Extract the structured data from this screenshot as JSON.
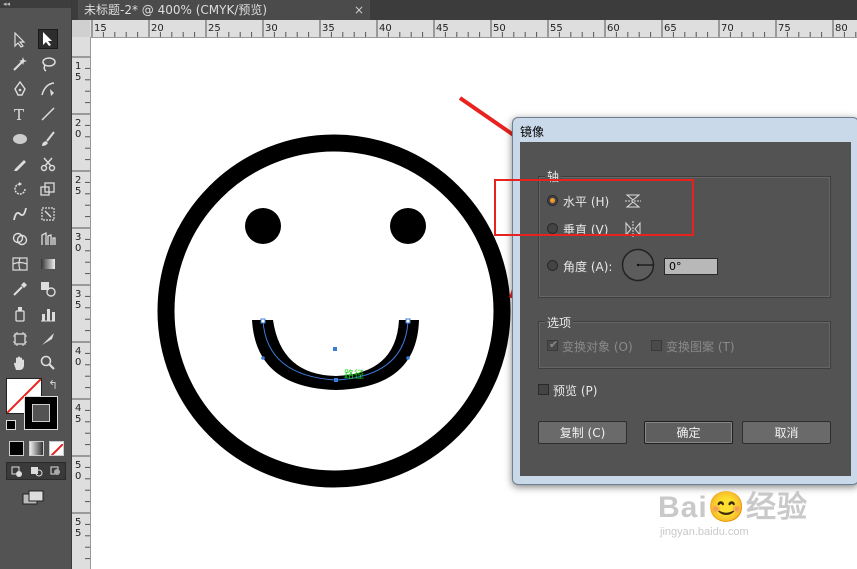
{
  "document_tab": {
    "title": "未标题-2* @ 400% (CMYK/预览)",
    "close": "×"
  },
  "ruler_h_labels": [
    "15",
    "20",
    "25",
    "30",
    "35",
    "40",
    "45",
    "50",
    "55",
    "60",
    "65",
    "70",
    "75",
    "80"
  ],
  "ruler_v_labels": [
    "1\n5",
    "2\n0",
    "2\n5",
    "3\n0",
    "3\n5",
    "4\n0",
    "4\n5",
    "5\n0",
    "5\n5"
  ],
  "artwork": {
    "path_label": "路径"
  },
  "dialog": {
    "title": "镜像",
    "axis_group": "轴",
    "horizontal_label": "水平 (H)",
    "vertical_label": "垂直 (V)",
    "angle_label": "角度 (A):",
    "angle_value": "0°",
    "options_group": "选项",
    "transform_objects_label": "变换对象 (O)",
    "transform_patterns_label": "变换图案 (T)",
    "preview_label": "预览 (P)",
    "copy_button": "复制 (C)",
    "ok_button": "确定",
    "cancel_button": "取消",
    "selected_axis": "horizontal"
  },
  "watermark": {
    "brand": "Bai😊经验",
    "url": "jingyan.baidu.com"
  },
  "colors": {
    "annotation_red": "#e8231f",
    "radio_selected": "#f29a2e",
    "selection_blue": "#3d7bd9",
    "path_label_green": "#19d219"
  }
}
